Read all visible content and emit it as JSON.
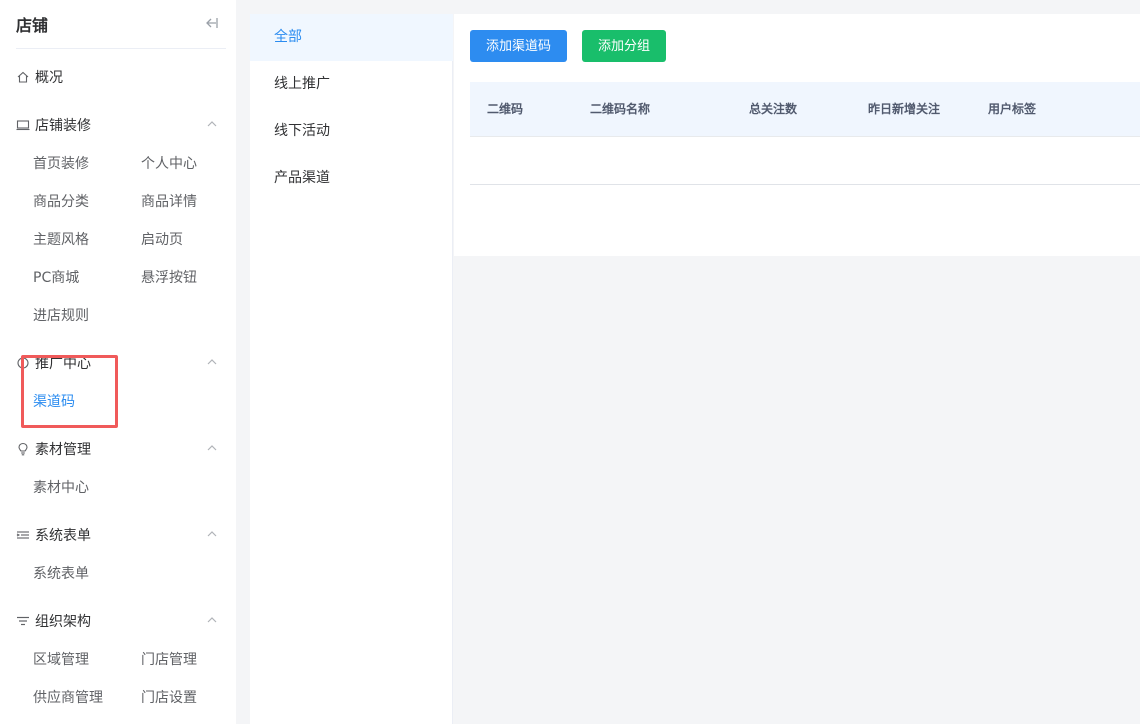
{
  "sidebar": {
    "title": "店铺",
    "overview": "概况",
    "groups": [
      {
        "label": "店铺装修",
        "items": [
          "首页装修",
          "个人中心",
          "商品分类",
          "商品详情",
          "主题风格",
          "启动页",
          "PC商城",
          "悬浮按钮",
          "进店规则"
        ]
      },
      {
        "label": "推广中心",
        "items": [
          "渠道码"
        ]
      },
      {
        "label": "素材管理",
        "items": [
          "素材中心"
        ]
      },
      {
        "label": "系统表单",
        "items": [
          "系统表单"
        ]
      },
      {
        "label": "组织架构",
        "items": [
          "区域管理",
          "门店管理",
          "供应商管理",
          "门店设置"
        ]
      }
    ]
  },
  "categories": [
    "全部",
    "线上推广",
    "线下活动",
    "产品渠道"
  ],
  "toolbar": {
    "add_channel_label": "添加渠道码",
    "add_group_label": "添加分组"
  },
  "table": {
    "columns": [
      "二维码",
      "二维码名称",
      "总关注数",
      "昨日新增关注",
      "用户标签"
    ],
    "rows": []
  },
  "colors": {
    "accent": "#2d8cf0",
    "green": "#19be6b",
    "highlight": "#f05a5a"
  }
}
